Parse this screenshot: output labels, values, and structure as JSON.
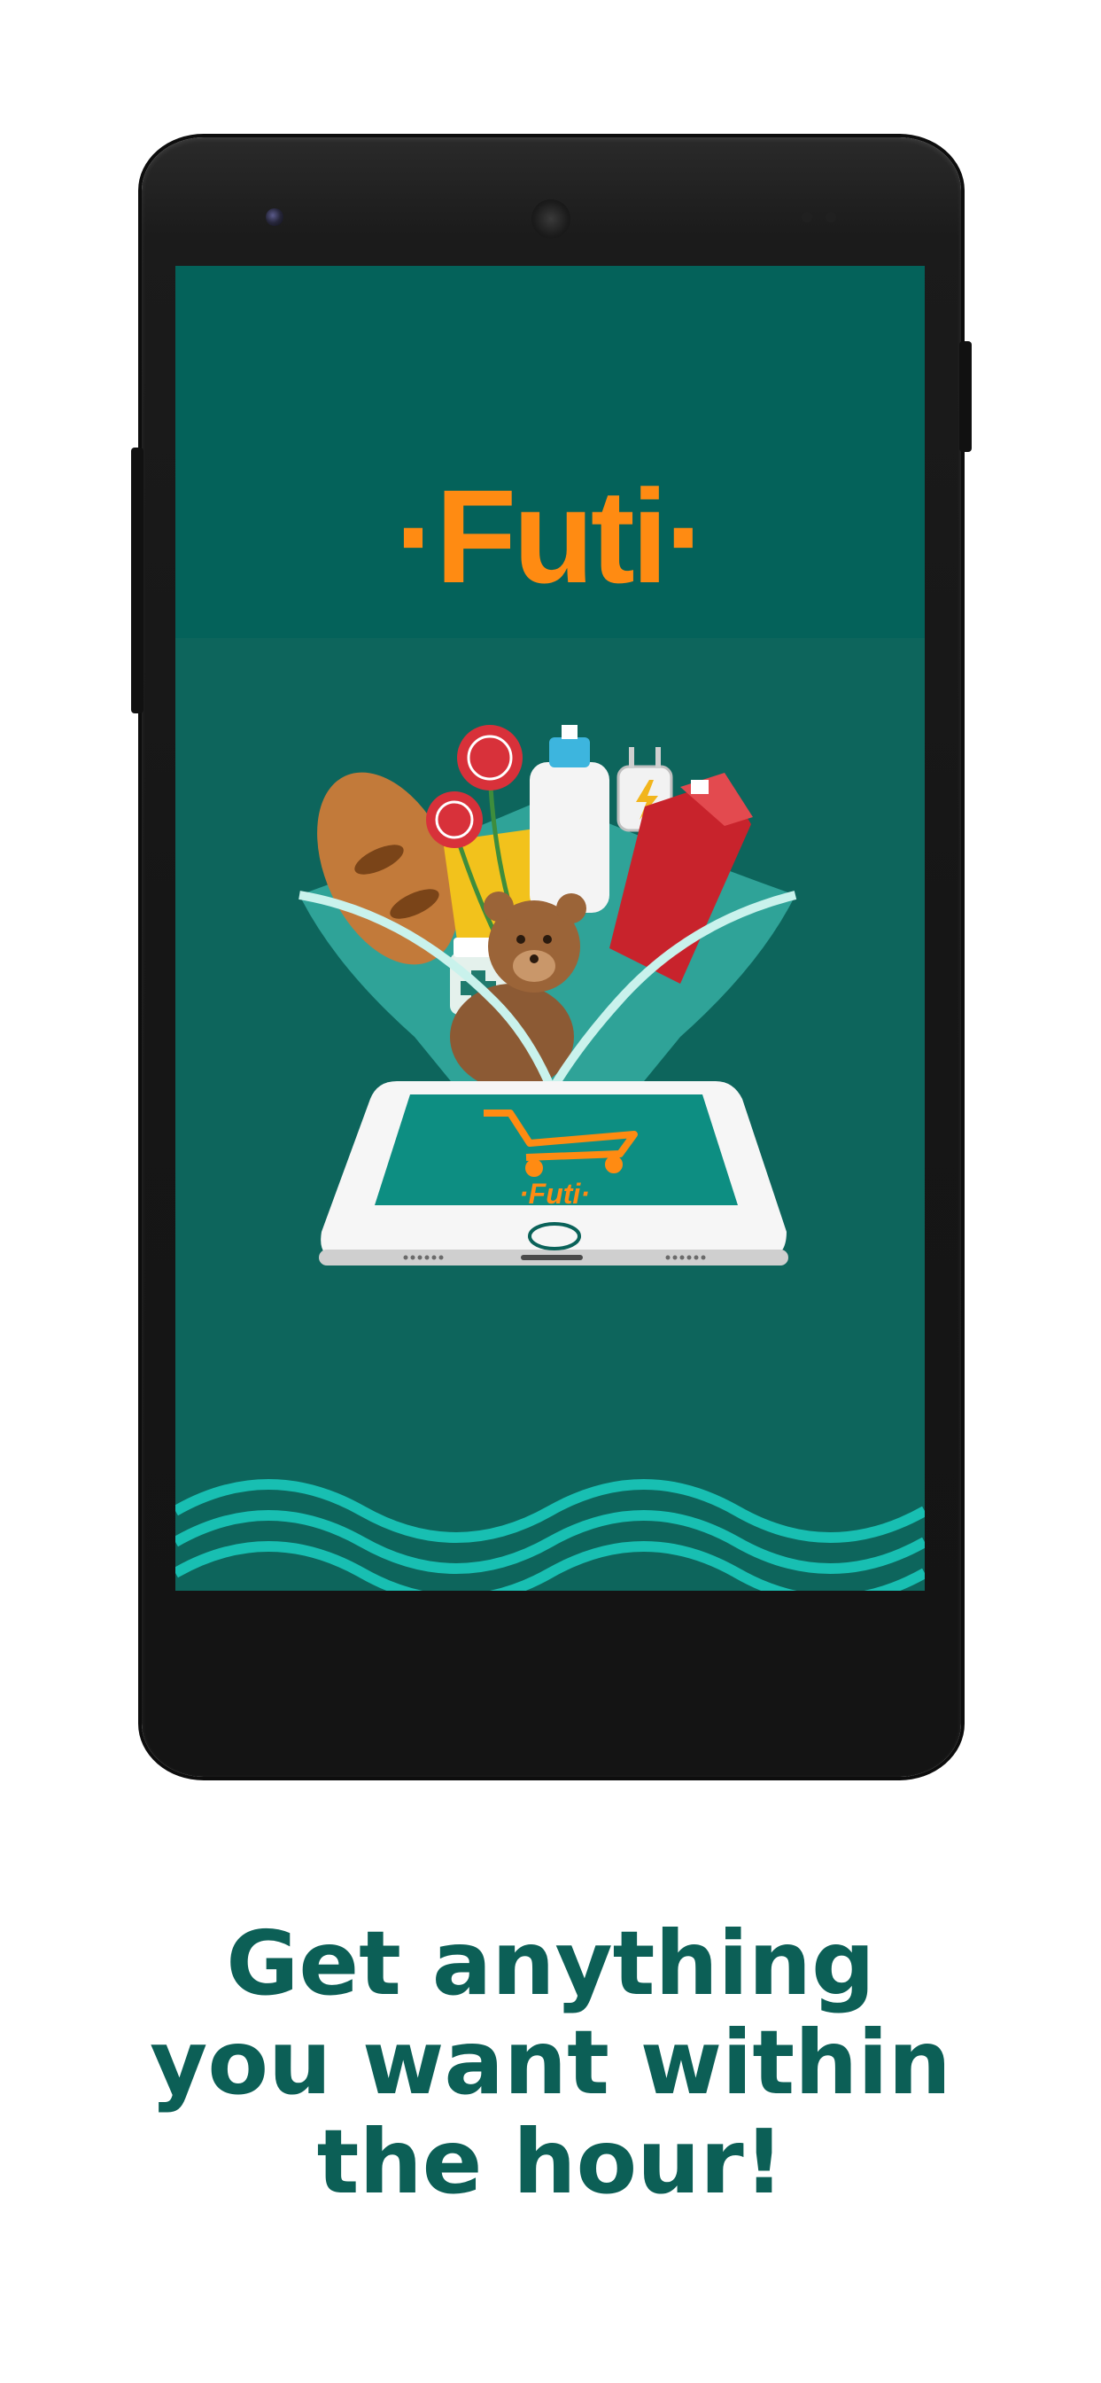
{
  "brand": {
    "name": "·Futi·",
    "mini_logo": "·Futi·",
    "color": "#ff8b12",
    "screen_color": "#0a6259"
  },
  "illustration": {
    "items": [
      "bread-icon",
      "roses-icon",
      "detergent-bottle-icon",
      "charger-icon",
      "juice-carton-icon",
      "teddy-bear-icon",
      "medicine-bottle-icon",
      "grocery-box-icon",
      "shopping-cart-icon",
      "tablet-icon"
    ]
  },
  "tagline": {
    "line1": "Get anything",
    "line2": "you want within",
    "line3": "the hour!",
    "color": "#0c5f56"
  }
}
